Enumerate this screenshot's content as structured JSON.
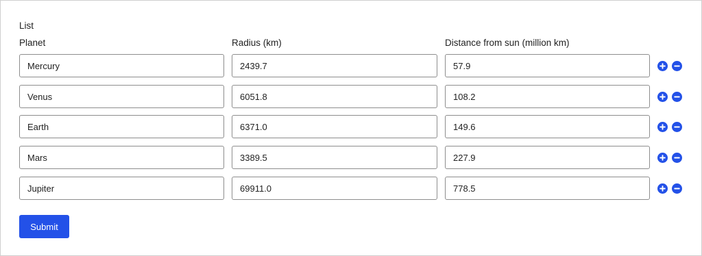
{
  "form": {
    "list_label": "List",
    "columns": {
      "planet": "Planet",
      "radius": "Radius (km)",
      "distance": "Distance from sun (million km)"
    },
    "rows": [
      {
        "planet": "Mercury",
        "radius": "2439.7",
        "distance": "57.9"
      },
      {
        "planet": "Venus",
        "radius": "6051.8",
        "distance": "108.2"
      },
      {
        "planet": "Earth",
        "radius": "6371.0",
        "distance": "149.6"
      },
      {
        "planet": "Mars",
        "radius": "3389.5",
        "distance": "227.9"
      },
      {
        "planet": "Jupiter",
        "radius": "69911.0",
        "distance": "778.5"
      }
    ],
    "row_icons": {
      "add": "plus-circle-icon",
      "remove": "minus-circle-icon"
    },
    "submit_label": "Submit"
  },
  "colors": {
    "accent": "#2351e8",
    "input_border": "#8d8d8d",
    "frame_border": "#cfcfcf"
  }
}
